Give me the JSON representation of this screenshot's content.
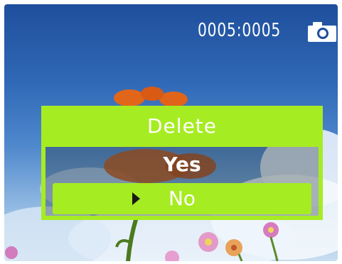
{
  "status_bar": {
    "image_counter": "0005:0005",
    "mode_icon": "camera-icon"
  },
  "dialog": {
    "title": "Delete",
    "options": [
      {
        "label": "Yes",
        "selected": false
      },
      {
        "label": "No",
        "selected": true
      }
    ],
    "selection_indicator_icon": "right-triangle-icon"
  },
  "colors": {
    "accent": "#a6ec22",
    "text": "#ffffff",
    "sky": "#2f68b6"
  }
}
